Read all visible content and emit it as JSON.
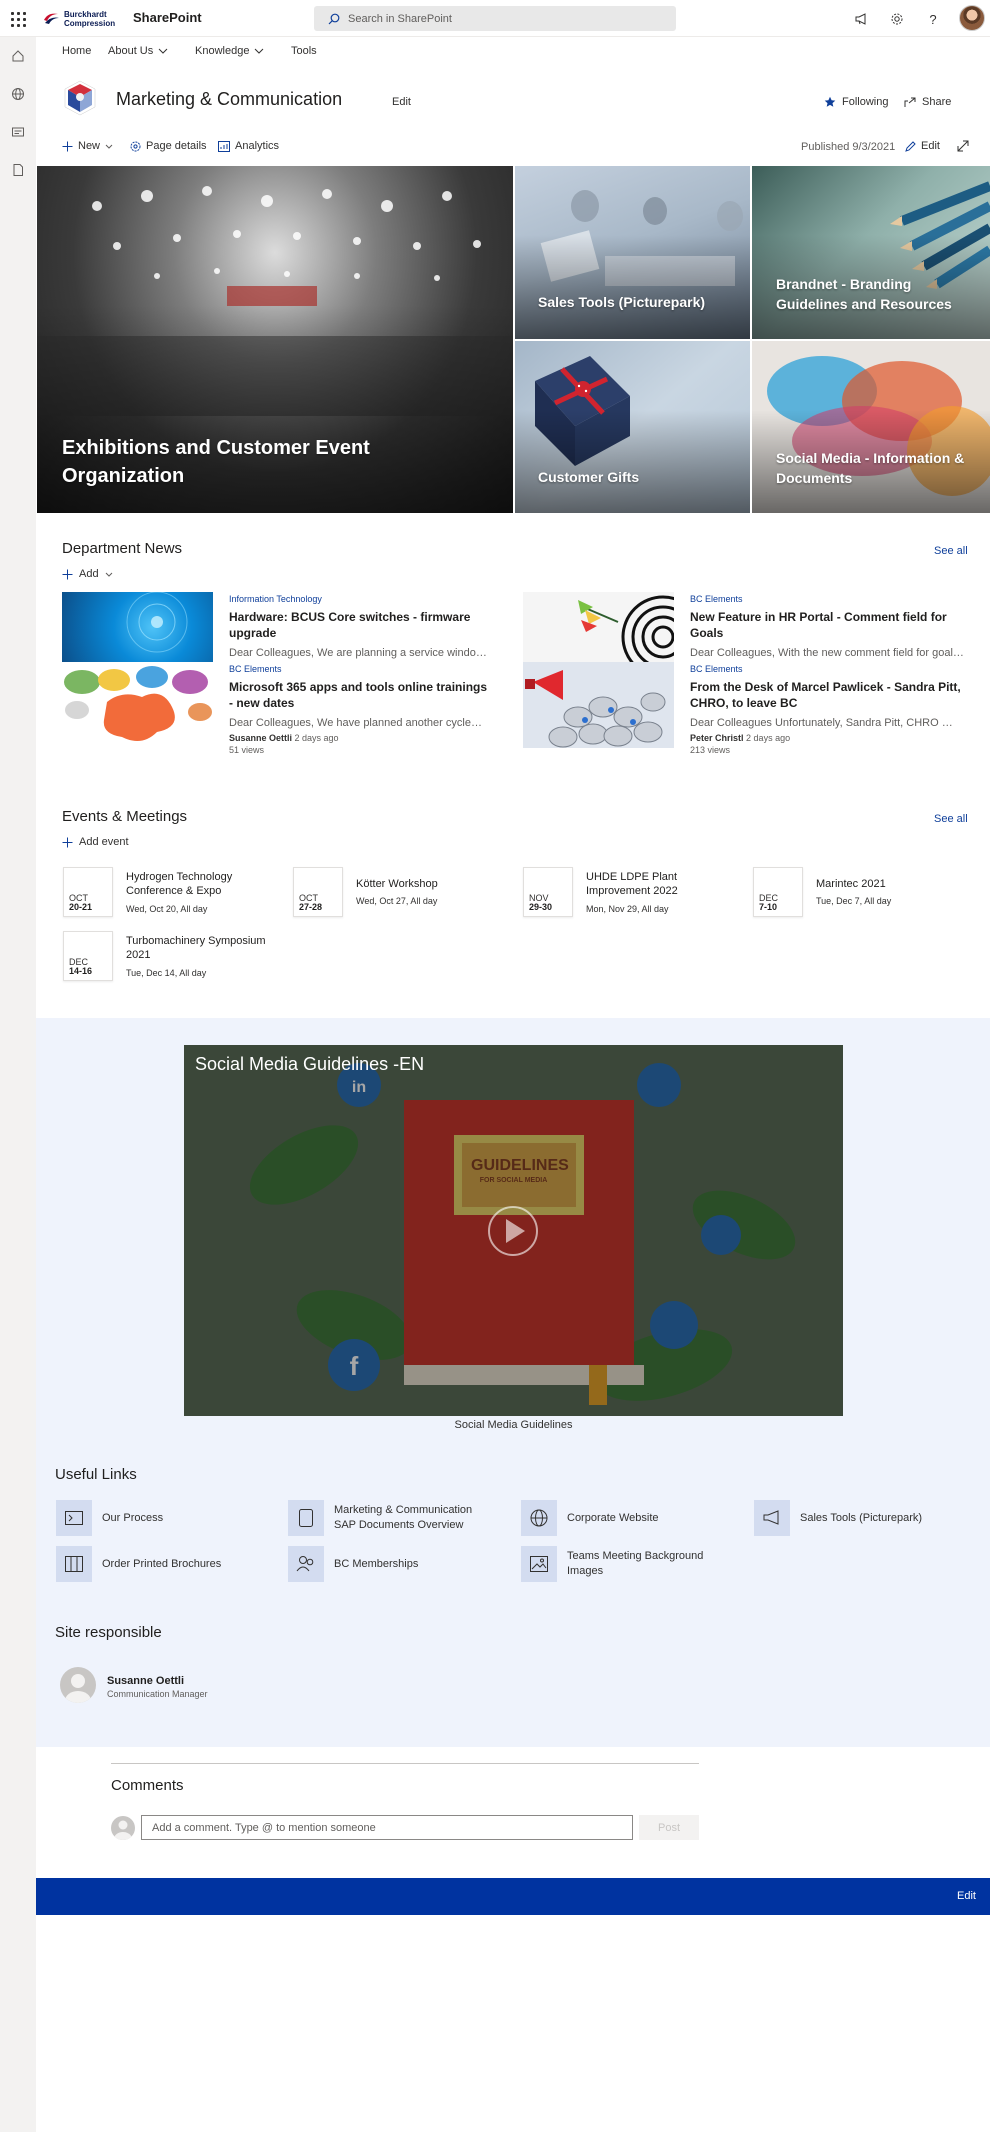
{
  "suite": {
    "logo_line1": "Burckhardt",
    "logo_line2": "Compression",
    "app_name": "SharePoint",
    "search_placeholder": "Search in SharePoint"
  },
  "nav": {
    "items": [
      "Home",
      "About Us",
      "Knowledge",
      "Tools"
    ]
  },
  "site": {
    "title": "Marketing & Communication",
    "edit": "Edit",
    "following": "Following",
    "share": "Share"
  },
  "commandbar": {
    "new": "New",
    "page_details": "Page details",
    "analytics": "Analytics",
    "published": "Published 9/3/2021",
    "edit": "Edit"
  },
  "hero": {
    "main": "Exhibitions and Customer Event Organization",
    "tile1": "Sales Tools (Picturepark)",
    "tile2": "Brandnet - Branding Guidelines and Resources",
    "tile3": "Customer Gifts",
    "tile4": "Social Media - Information & Documents"
  },
  "news": {
    "title": "Department News",
    "see_all": "See all",
    "add": "Add",
    "items": [
      {
        "category": "Information Technology",
        "title": "Hardware: BCUS Core switches - firmware upgrade",
        "desc": "Dear Colleagues, We are planning a service window to..."
      },
      {
        "category": "BC Elements",
        "title": "Microsoft 365 apps and tools online trainings - new dates",
        "desc": "Dear Colleagues, We have planned another cycle of...",
        "author": "Susanne Oettli",
        "time": "2 days ago",
        "views": "51 views"
      },
      {
        "category": "BC Elements",
        "title": "New Feature in HR Portal - Comment field for Goals",
        "desc": "Dear Colleagues, With the new comment field for goals..."
      },
      {
        "category": "BC Elements",
        "title": "From the Desk of Marcel Pawlicek - Sandra Pitt, CHRO, to leave BC",
        "desc": "Dear Colleagues Unfortunately, Sandra Pitt, CHRO and...",
        "author": "Peter Christl",
        "time": "2 days ago",
        "views": "213 views"
      }
    ]
  },
  "events": {
    "title": "Events & Meetings",
    "see_all": "See all",
    "add": "Add event",
    "items": [
      {
        "month": "OCT",
        "days": "20-21",
        "title": "Hydrogen Technology Conference & Expo",
        "when": "Wed, Oct 20, All day"
      },
      {
        "month": "OCT",
        "days": "27-28",
        "title": "Kötter Workshop",
        "when": "Wed, Oct 27, All day"
      },
      {
        "month": "NOV",
        "days": "29-30",
        "title": "UHDE LDPE Plant Improvement 2022",
        "when": "Mon, Nov 29, All day"
      },
      {
        "month": "DEC",
        "days": "7-10",
        "title": "Marintec 2021",
        "when": "Tue, Dec 7, All day"
      },
      {
        "month": "DEC",
        "days": "14-16",
        "title": "Turbomachinery Symposium 2021",
        "when": "Tue, Dec 14, All day"
      }
    ]
  },
  "video": {
    "title": "Social Media Guidelines -EN",
    "book_line1": "GUIDELINES",
    "book_line2": "FOR SOCIAL MEDIA",
    "caption": "Social Media Guidelines"
  },
  "useful_links": {
    "title": "Useful Links",
    "items": [
      {
        "label": "Our Process",
        "icon": "process-icon"
      },
      {
        "label": "Marketing & Communication SAP Documents Overview",
        "icon": "document-icon"
      },
      {
        "label": "Corporate Website",
        "icon": "globe-icon"
      },
      {
        "label": "Sales Tools (Picturepark)",
        "icon": "megaphone-icon"
      },
      {
        "label": "Order Printed Brochures",
        "icon": "brochure-icon"
      },
      {
        "label": "BC Memberships",
        "icon": "people-icon"
      },
      {
        "label": "Teams Meeting Background Images",
        "icon": "image-icon"
      }
    ]
  },
  "responsible": {
    "title": "Site responsible",
    "name": "Susanne Oettli",
    "role": "Communication Manager"
  },
  "comments": {
    "title": "Comments",
    "placeholder": "Add a comment. Type @ to mention someone",
    "post": "Post"
  },
  "footer": {
    "edit": "Edit"
  },
  "colors": {
    "accent": "#0033a0",
    "link": "#0f3f9a",
    "section_bg": "#eff3fc"
  }
}
